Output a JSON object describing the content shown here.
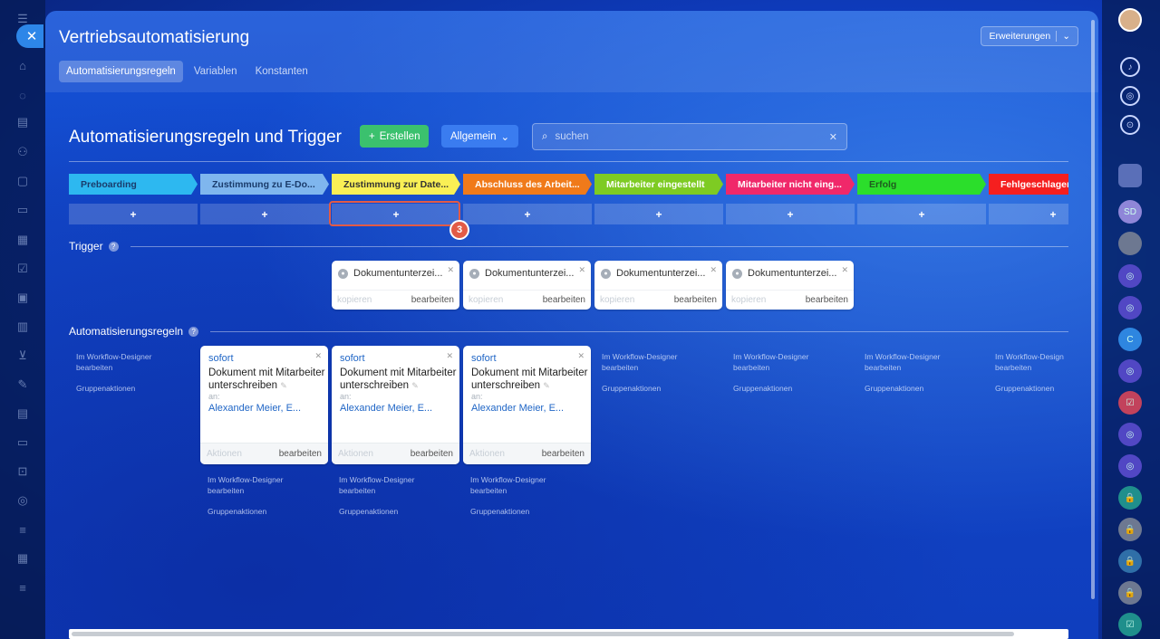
{
  "app": {
    "title": "Vertriebsautomatisierung",
    "extensions_label": "Erweiterungen",
    "tabs": [
      {
        "label": "Automatisierungsregeln",
        "active": true
      },
      {
        "label": "Variablen",
        "active": false
      },
      {
        "label": "Konstanten",
        "active": false
      }
    ]
  },
  "toolbar": {
    "heading": "Automatisierungsregeln und Trigger",
    "create_label": "Erstellen",
    "general_label": "Allgemein",
    "search_placeholder": "suchen"
  },
  "stages": [
    {
      "label": "Preboarding",
      "color": "#2db8f0",
      "text_color": "#1a3b6b"
    },
    {
      "label": "Zustimmung zu E-Do...",
      "color": "#7fb6ee",
      "text_color": "#1a3b6b"
    },
    {
      "label": "Zustimmung zur Date...",
      "color": "#f9ef55",
      "text_color": "#333333"
    },
    {
      "label": "Abschluss des Arbeit...",
      "color": "#f07a1a",
      "text_color": "#ffffff"
    },
    {
      "label": "Mitarbeiter eingestellt",
      "color": "#7ecb23",
      "text_color": "#ffffff"
    },
    {
      "label": "Mitarbeiter nicht eing...",
      "color": "#f0286a",
      "text_color": "#ffffff"
    },
    {
      "label": "Erfolg",
      "color": "#2bde2b",
      "text_color": "#1f5c1f"
    },
    {
      "label": "Fehlgeschlagen",
      "color": "#f51f1f",
      "text_color": "#ffffff"
    }
  ],
  "add_label": "+",
  "step_badge": "3",
  "trigger_section": {
    "label": "Trigger",
    "cards": [
      {
        "name": "Dokumentunterzei...",
        "copy": "kopieren",
        "edit": "bearbeiten"
      },
      {
        "name": "Dokumentunterzei...",
        "copy": "kopieren",
        "edit": "bearbeiten"
      },
      {
        "name": "Dokumentunterzei...",
        "copy": "kopieren",
        "edit": "bearbeiten"
      },
      {
        "name": "Dokumentunterzei...",
        "copy": "kopieren",
        "edit": "bearbeiten"
      }
    ]
  },
  "rules_section": {
    "label": "Automatisierungsregeln",
    "designer_line1": "Im Workflow-Designer",
    "designer_line2": "bearbeiten",
    "group_actions": "Gruppenaktionen",
    "designer_line1_cut": "Im Workflow-Design",
    "cards": [
      {
        "when": "sofort",
        "title": "Dokument mit Mitarbeiter unterschreiben",
        "to_label": "an:",
        "recipients": "Alexander Meier, E...",
        "actions": "Aktionen",
        "edit": "bearbeiten"
      },
      {
        "when": "sofort",
        "title": "Dokument mit Mitarbeiter unterschreiben",
        "to_label": "an:",
        "recipients": "Alexander Meier, E...",
        "actions": "Aktionen",
        "edit": "bearbeiten"
      },
      {
        "when": "sofort",
        "title": "Dokument mit Mitarbeiter unterschreiben",
        "to_label": "an:",
        "recipients": "Alexander Meier, E...",
        "actions": "Aktionen",
        "edit": "bearbeiten"
      }
    ]
  },
  "right_sidebar": {
    "avatars": [
      "SD",
      "C"
    ]
  },
  "icons": {
    "close": "close-icon",
    "search": "search-icon",
    "help": "help-icon",
    "pencil": "pencil-icon",
    "trigger": "trigger-icon"
  }
}
